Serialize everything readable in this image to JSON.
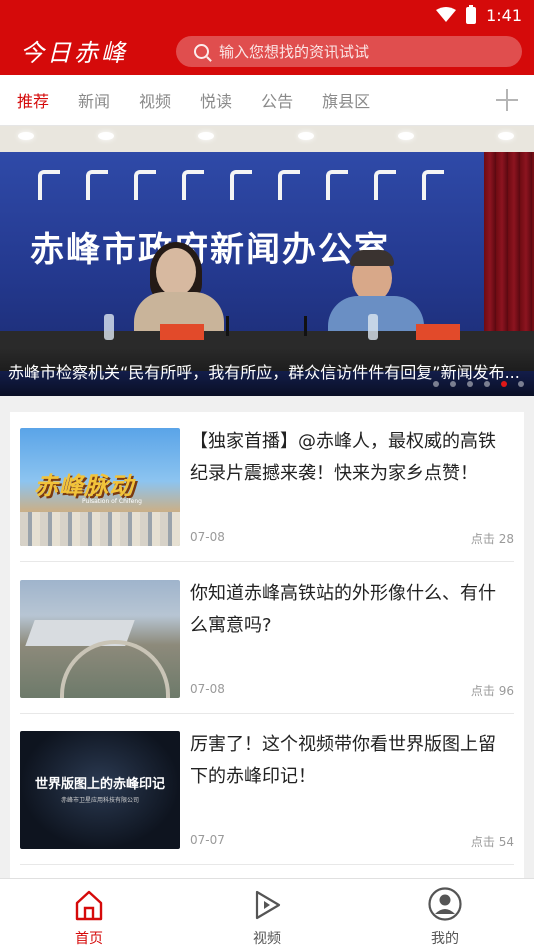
{
  "status_bar": {
    "time": "1:41"
  },
  "header": {
    "logo_text": "今日赤峰",
    "search_placeholder": "输入您想找的资讯试试"
  },
  "tabs": [
    {
      "label": "推荐",
      "active": true
    },
    {
      "label": "新闻",
      "active": false
    },
    {
      "label": "视频",
      "active": false
    },
    {
      "label": "悦读",
      "active": false
    },
    {
      "label": "公告",
      "active": false
    },
    {
      "label": "旗县区",
      "active": false
    }
  ],
  "banner": {
    "hall_title": "赤峰市政府新闻办公室",
    "caption": "赤峰市检察机关“民有所呼，我有所应，群众信访件件有回复”新闻发布...",
    "dot_count": 6,
    "active_dot": 5
  },
  "articles": [
    {
      "title": "【独家首播】@赤峰人，最权威的高铁纪录片震撼来袭！快来为家乡点赞！",
      "date": "07-08",
      "clicks": "点击 28",
      "thumb_logo": "赤峰脉动",
      "thumb_sub": "Pulsation of Chifeng"
    },
    {
      "title": "你知道赤峰高铁站的外形像什么、有什么寓意吗?",
      "date": "07-08",
      "clicks": "点击 96"
    },
    {
      "title": "厉害了！这个视频带你看世界版图上留下的赤峰印记！",
      "date": "07-07",
      "clicks": "点击 54",
      "thumb_text": "世界版图上的赤峰印记",
      "thumb_sub": "赤峰市卫星应用科技有限公司"
    }
  ],
  "bottom_nav": [
    {
      "label": "首页",
      "icon": "home-icon",
      "active": true
    },
    {
      "label": "视频",
      "icon": "play-icon",
      "active": false
    },
    {
      "label": "我的",
      "icon": "user-icon",
      "active": false
    }
  ],
  "colors": {
    "brand_red": "#d50a0a",
    "text_gray": "#8a8a8a"
  }
}
